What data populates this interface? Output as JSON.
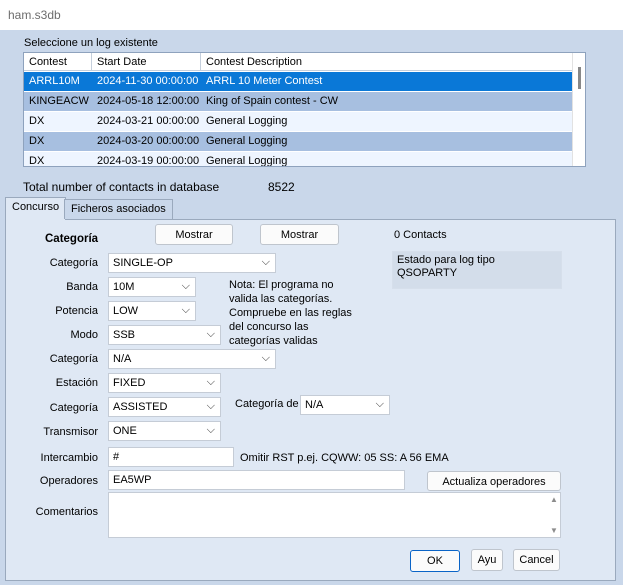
{
  "window": {
    "title": "ham.s3db"
  },
  "log_selector": {
    "label": "Seleccione un log existente",
    "columns": [
      "Contest",
      "Start Date",
      "Contest Description"
    ],
    "rows": [
      {
        "contest": "ARRL10M",
        "start": "2024-11-30 00:00:00",
        "desc": "ARRL 10 Meter Contest"
      },
      {
        "contest": "KINGEACW",
        "start": "2024-05-18 12:00:00",
        "desc": "King of Spain contest - CW"
      },
      {
        "contest": "DX",
        "start": "2024-03-21 00:00:00",
        "desc": "General Logging"
      },
      {
        "contest": "DX",
        "start": "2024-03-20 00:00:00",
        "desc": "General Logging"
      },
      {
        "contest": "DX",
        "start": "2024-03-19 00:00:00",
        "desc": "General Logging"
      }
    ]
  },
  "totals": {
    "label": "Total number of contacts in database",
    "value": "8522"
  },
  "tabs": [
    "Concurso",
    "Ficheros asociados"
  ],
  "form": {
    "heading": "Categoría",
    "mostrar1": "Mostrar",
    "mostrar2": "Mostrar",
    "contacts": "0 Contacts",
    "status_title": "Estado para log tipo",
    "status_value": "QSOPARTY",
    "categoria_label": "Categoría",
    "categoria_value": "SINGLE-OP",
    "banda_label": "Banda",
    "banda_value": "10M",
    "potencia_label": "Potencia",
    "potencia_value": "LOW",
    "modo_label": "Modo",
    "modo_value": "SSB",
    "categoria2_label": "Categoría",
    "categoria2_value": "N/A",
    "estacion_label": "Estación",
    "estacion_value": "FIXED",
    "categoria3_label": "Categoría",
    "categoria3_value": "ASSISTED",
    "categoria_de_label": "Categoría de",
    "categoria_de_value": "N/A",
    "transmisor_label": "Transmisor",
    "transmisor_value": "ONE",
    "intercambio_label": "Intercambio",
    "intercambio_value": "#",
    "intercambio_hint": "Omitir RST p.ej. CQWW: 05 SS: A 56 EMA",
    "operadores_label": "Operadores",
    "operadores_value": "EA5WP",
    "actualiza_button": "Actualiza operadores",
    "comentarios_label": "Comentarios",
    "note": "Nota: El programa no valida las categorías. Compruebe en las reglas del concurso las categorías validas",
    "ok": "OK",
    "ayu": "Ayu",
    "cancel": "Cancel"
  },
  "colors": {
    "selected": "#0a78d7",
    "alt_row": "#a7bfe0",
    "background": "#c9d7ea",
    "panel": "#dfe8f4"
  }
}
